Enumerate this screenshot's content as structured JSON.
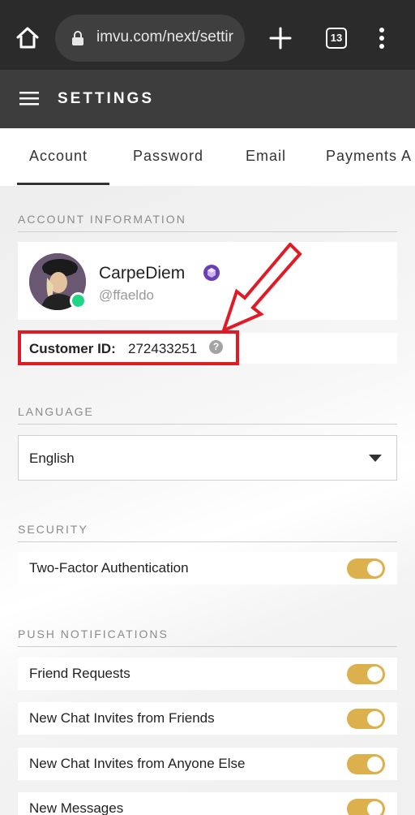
{
  "browser": {
    "url": "imvu.com/next/settir",
    "tab_count": "13"
  },
  "header": {
    "title": "SETTINGS"
  },
  "tabs": [
    {
      "label": "Account",
      "active": true
    },
    {
      "label": "Password",
      "active": false
    },
    {
      "label": "Email",
      "active": false
    },
    {
      "label": "Payments A",
      "active": false
    }
  ],
  "account_information": {
    "section_title": "ACCOUNT INFORMATION",
    "display_name": "CarpeDiem",
    "username": "@ffaeldo",
    "customer_id_label": "Customer ID:",
    "customer_id_value": "272433251",
    "help_glyph": "?"
  },
  "language": {
    "section_title": "LANGUAGE",
    "selected": "English"
  },
  "security": {
    "section_title": "SECURITY",
    "items": [
      {
        "label": "Two-Factor Authentication",
        "enabled": true
      }
    ]
  },
  "push_notifications": {
    "section_title": "PUSH NOTIFICATIONS",
    "items": [
      {
        "label": "Friend Requests",
        "enabled": true
      },
      {
        "label": "New Chat Invites from Friends",
        "enabled": true
      },
      {
        "label": "New Chat Invites from Anyone Else",
        "enabled": true
      },
      {
        "label": "New Messages",
        "enabled": true
      }
    ]
  },
  "colors": {
    "toggle_on": "#dcb04c",
    "highlight": "#e01b25",
    "online": "#1fd687",
    "vip_badge": "#6a3fb5"
  },
  "icons": [
    "home-icon",
    "lock-icon",
    "plus-icon",
    "tabs-counter-icon",
    "overflow-menu-icon",
    "hamburger-icon",
    "online-status-icon",
    "vip-badge-icon",
    "help-icon",
    "dropdown-caret-icon",
    "red-arrow-icon"
  ]
}
